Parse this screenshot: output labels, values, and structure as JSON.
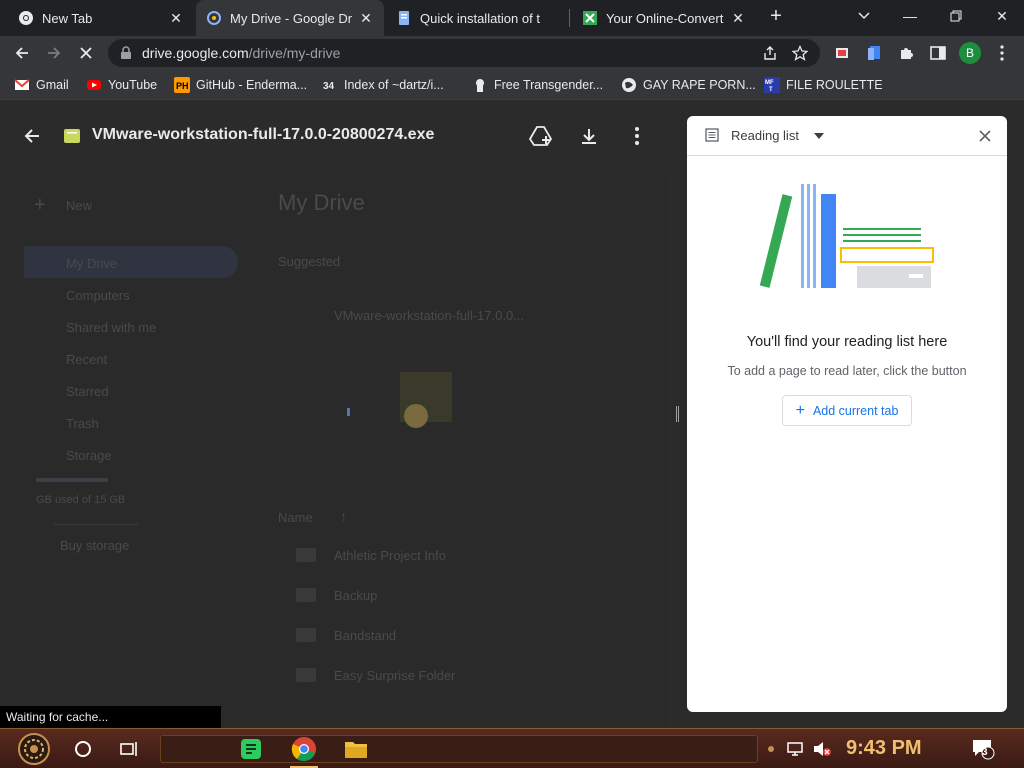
{
  "tabs": [
    {
      "title": "New Tab",
      "icon": "chrome-icon"
    },
    {
      "title": "My Drive - Google Drive",
      "icon": "google-drive-icon"
    },
    {
      "title": "Quick installation of t",
      "icon": "document-icon"
    },
    {
      "title": "Your Online-Convert",
      "icon": "converter-icon"
    }
  ],
  "address": {
    "host": "drive.google.com",
    "path": "/drive/my-drive"
  },
  "profile_initial": "B",
  "bookmarks": [
    {
      "label": "Gmail"
    },
    {
      "label": "YouTube"
    },
    {
      "label": "GitHub - Enderma..."
    },
    {
      "label": "Index of ~dartz/i..."
    },
    {
      "label": "Free Transgender..."
    },
    {
      "label": "GAY RAPE PORN..."
    },
    {
      "label": "FILE ROULETTE"
    }
  ],
  "preview": {
    "file_name": "VMware-workstation-full-17.0.0-20800274.exe"
  },
  "drive": {
    "new_label": "New",
    "heading": "My Drive",
    "suggested": "Suggested",
    "sidebar": [
      "My Drive",
      "Computers",
      "Shared with me",
      "Recent",
      "Starred",
      "Trash",
      "Storage"
    ],
    "storage_text": "GB used of 15 GB",
    "buy_storage": "Buy storage",
    "suggested_file": "VMware-workstation-full-17.0.0...",
    "sort_label": "Name",
    "folders": [
      "Athletic Project Info",
      "Backup",
      "Bandstand",
      "Easy Surprise Folder"
    ]
  },
  "reading_list": {
    "title": "Reading list",
    "message": "You'll find your reading list here",
    "sub": "To add a page to read later, click the button",
    "button": "Add current tab"
  },
  "status_text": "Waiting for cache...",
  "clock": "9:43 PM",
  "notification_count": "3",
  "colors": {
    "accent": "#1a73e8",
    "taskbar": "#4a2218",
    "clock": "#f0c070"
  }
}
